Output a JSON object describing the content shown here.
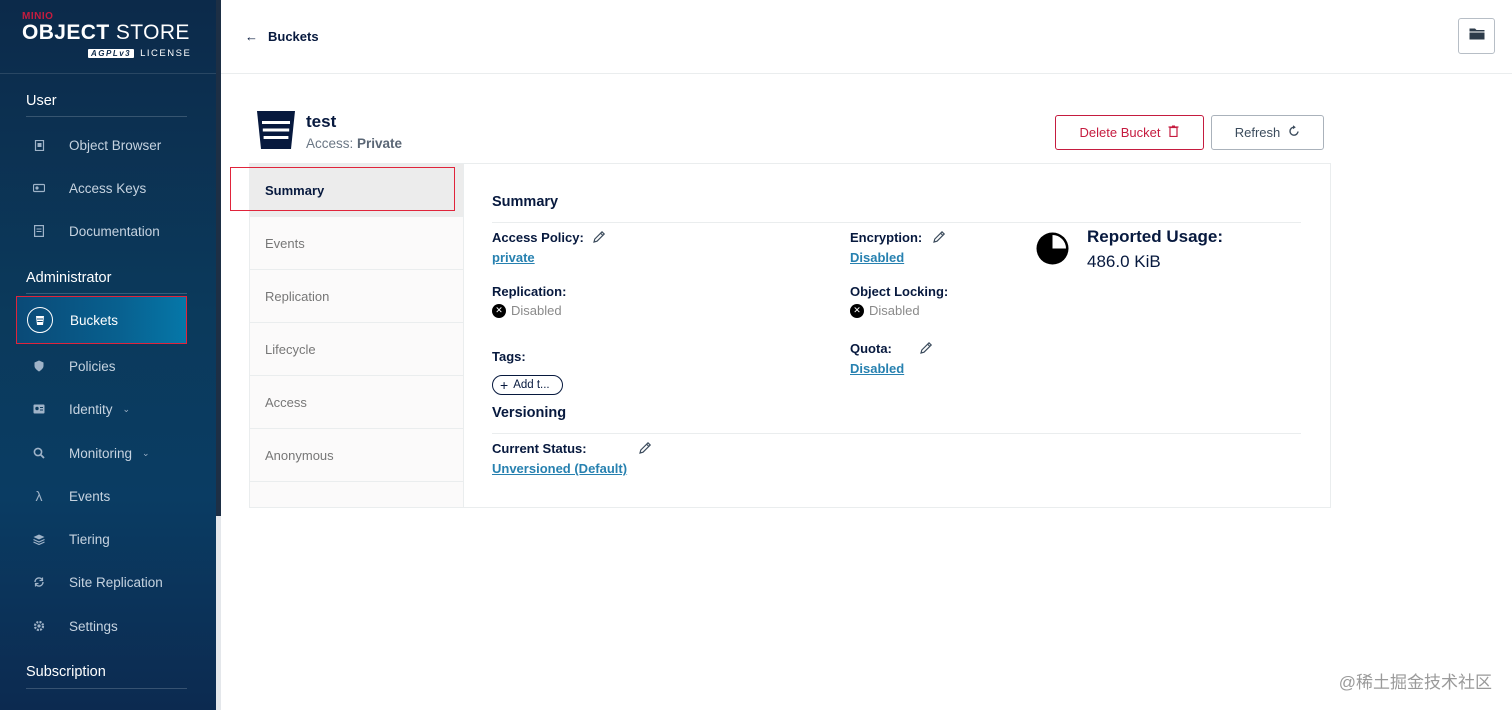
{
  "brand": {
    "minio": "MINIO",
    "store_bold": "OBJECT",
    "store_rest": " STORE",
    "agpl": "AGPLv3",
    "license": "LICENSE"
  },
  "sidebar": {
    "user_title": "User",
    "user_items": [
      {
        "label": "Object Browser",
        "icon": "object-browser-icon"
      },
      {
        "label": "Access Keys",
        "icon": "access-keys-icon"
      },
      {
        "label": "Documentation",
        "icon": "documentation-icon"
      }
    ],
    "admin_title": "Administrator",
    "admin_items": [
      {
        "label": "Buckets",
        "icon": "buckets-icon",
        "active": true
      },
      {
        "label": "Policies",
        "icon": "policies-icon"
      },
      {
        "label": "Identity",
        "icon": "identity-icon",
        "expandable": true
      },
      {
        "label": "Monitoring",
        "icon": "monitoring-icon",
        "expandable": true
      },
      {
        "label": "Events",
        "icon": "lambda-icon"
      },
      {
        "label": "Tiering",
        "icon": "tiering-icon"
      },
      {
        "label": "Site Replication",
        "icon": "site-replication-icon"
      },
      {
        "label": "Settings",
        "icon": "settings-icon"
      }
    ],
    "subscription_title": "Subscription"
  },
  "topbar": {
    "back_label": "Buckets"
  },
  "bucket": {
    "name": "test",
    "access_prefix": "Access: ",
    "access_value": "Private",
    "delete_label": "Delete Bucket",
    "refresh_label": "Refresh"
  },
  "tabs": [
    "Summary",
    "Events",
    "Replication",
    "Lifecycle",
    "Access",
    "Anonymous"
  ],
  "summary": {
    "title": "Summary",
    "access_policy_label": "Access Policy:",
    "access_policy_value": "private",
    "encryption_label": "Encryption:",
    "encryption_value": "Disabled",
    "replication_label": "Replication:",
    "replication_value": "Disabled",
    "object_locking_label": "Object Locking:",
    "object_locking_value": "Disabled",
    "tags_label": "Tags:",
    "add_tag_label": "Add t...",
    "quota_label": "Quota:",
    "quota_value": "Disabled",
    "reported_usage_label": "Reported Usage:",
    "reported_usage_value": "486.0 KiB"
  },
  "versioning": {
    "title": "Versioning",
    "current_status_label": "Current Status:",
    "current_status_value": "Unversioned (Default)"
  },
  "watermark": "@稀土掘金技术社区",
  "colors": {
    "accent_red": "#c51b3f",
    "link_blue": "#2781b0",
    "navy": "#07193e"
  }
}
